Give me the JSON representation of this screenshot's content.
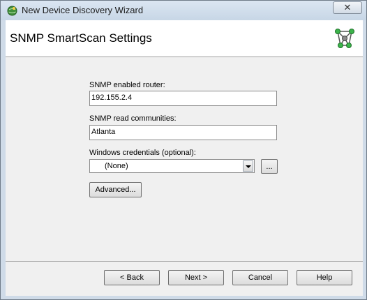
{
  "window": {
    "title": "New Device Discovery Wizard",
    "close_symbol": "✕"
  },
  "header": {
    "title": "SNMP SmartScan Settings",
    "logo_icon": "network-cube-icon"
  },
  "form": {
    "router_label": "SNMP enabled router:",
    "router_value": "192.155.2.4",
    "communities_label": "SNMP read communities:",
    "communities_value": "Atlanta",
    "credentials_label": "Windows credentials (optional):",
    "credentials_value": "(None)",
    "browse_label": "...",
    "advanced_label": "Advanced..."
  },
  "footer": {
    "back_label": "< Back",
    "next_label": "Next >",
    "cancel_label": "Cancel",
    "help_label": "Help"
  },
  "colors": {
    "frame": "#cfdbe8",
    "panel": "#f0f0f0",
    "logo": "#3cb44b"
  }
}
